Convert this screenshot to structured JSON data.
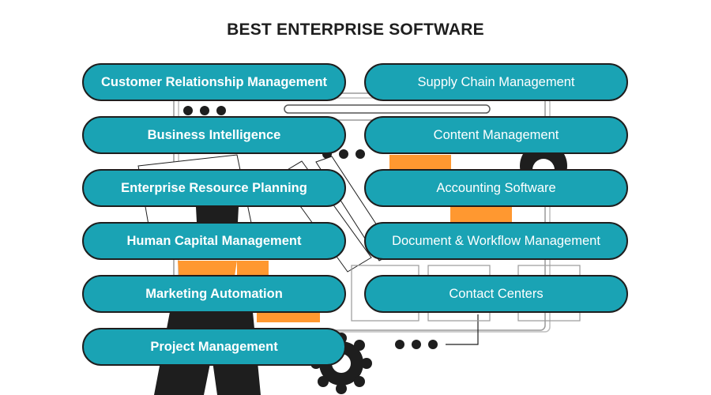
{
  "title": "BEST ENTERPRISE SOFTWARE",
  "colors": {
    "pill_fill": "#1aa3b4",
    "pill_border": "#1e1e1e",
    "pill_text": "#ffffff",
    "accent_orange": "#ff9830",
    "ink": "#1e1e1e"
  },
  "left_column": [
    {
      "label": "Customer Relationship Management"
    },
    {
      "label": "Business Intelligence"
    },
    {
      "label": "Enterprise Resource Planning"
    },
    {
      "label": "Human Capital Management"
    },
    {
      "label": "Marketing Automation"
    },
    {
      "label": "Project Management"
    }
  ],
  "right_column": [
    {
      "label": "Supply Chain Management"
    },
    {
      "label": "Content Management"
    },
    {
      "label": "Accounting Software"
    },
    {
      "label": "Document & Workflow Management"
    },
    {
      "label": "Contact Centers"
    }
  ]
}
